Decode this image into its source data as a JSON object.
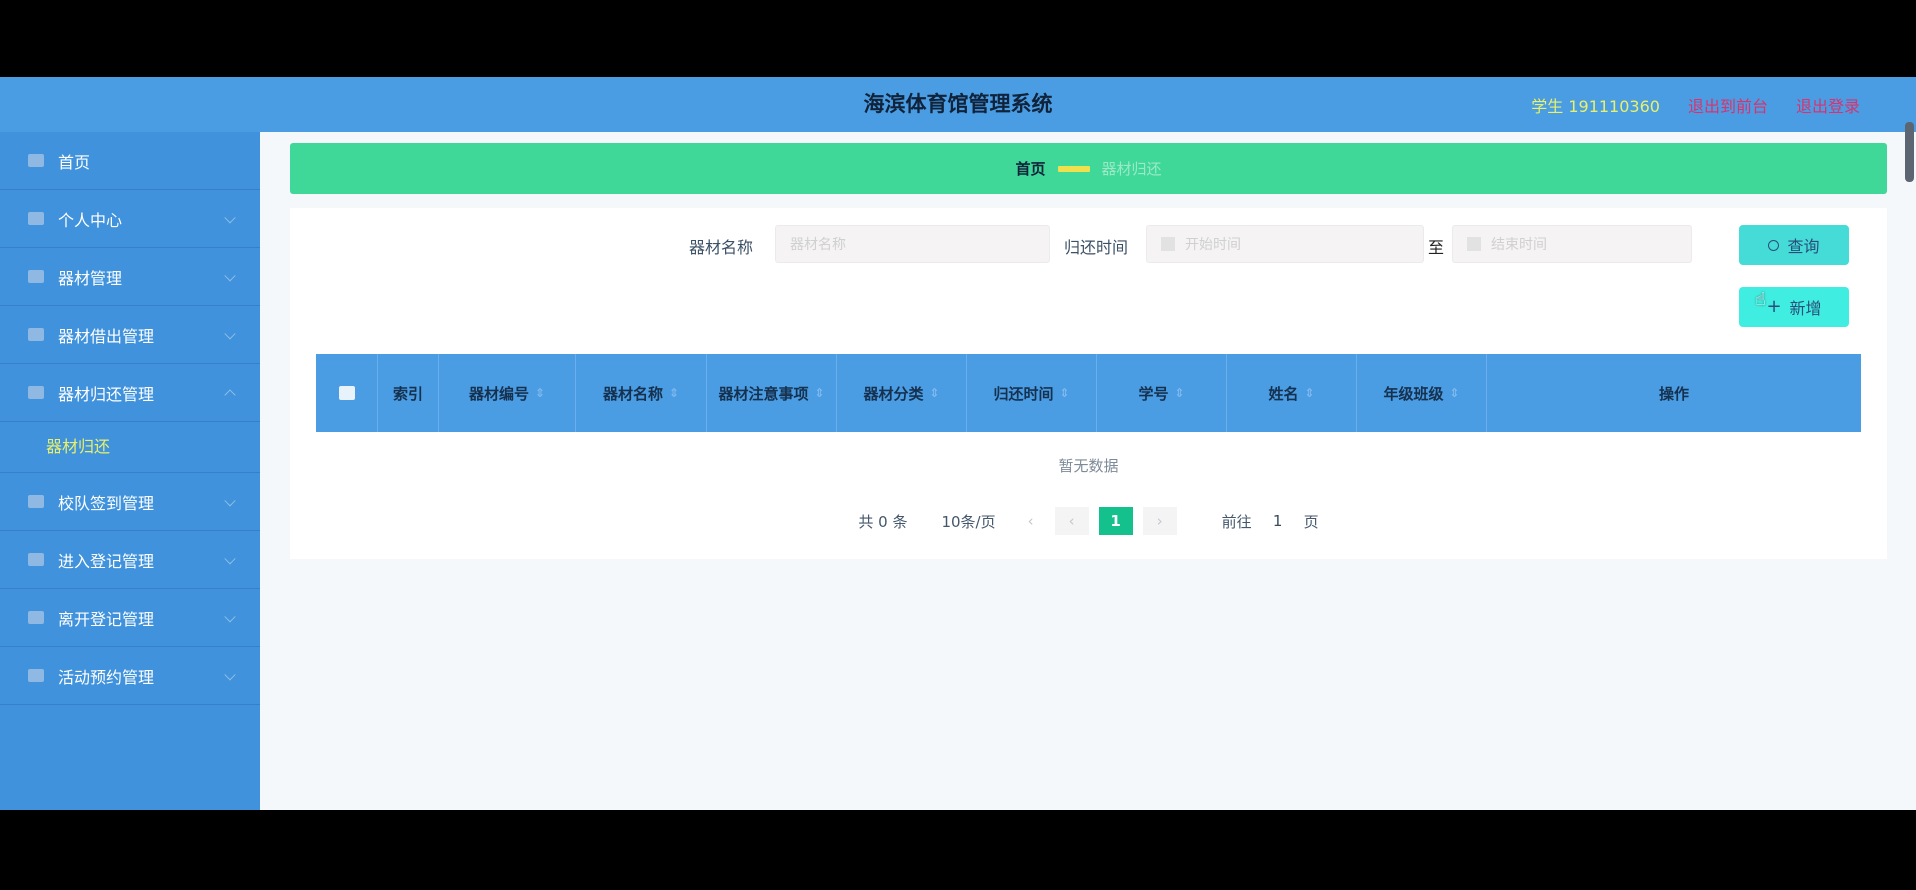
{
  "header": {
    "title": "海滨体育馆管理系统",
    "user": "学生 191110360",
    "link1": "退出到前台",
    "link2": "退出登录"
  },
  "sidebar": {
    "items": [
      {
        "label": "首页",
        "icon": "home-icon"
      },
      {
        "label": "个人中心",
        "icon": "user-icon"
      },
      {
        "label": "器材管理",
        "icon": "equipment-icon"
      },
      {
        "label": "器材借出管理",
        "icon": "lend-icon"
      },
      {
        "label": "器材归还管理",
        "icon": "return-icon"
      },
      {
        "label": "器材归还",
        "sub": true
      },
      {
        "label": "校队签到管理",
        "icon": "folder-icon"
      },
      {
        "label": "进入登记管理",
        "icon": "enter-icon"
      },
      {
        "label": "离开登记管理",
        "icon": "leave-icon"
      },
      {
        "label": "活动预约管理",
        "icon": "calendar-icon"
      }
    ]
  },
  "breadcrumb": {
    "home": "首页",
    "current": "器材归还"
  },
  "search": {
    "name_label": "器材名称",
    "name_placeholder": "器材名称",
    "time_label": "归还时间",
    "start_placeholder": "开始时间",
    "to_label": "至",
    "end_placeholder": "结束时间",
    "search_button": "查询",
    "add_button": "新增"
  },
  "table": {
    "columns": [
      "",
      "索引",
      "器材编号",
      "器材名称",
      "器材注意事项",
      "器材分类",
      "归还时间",
      "学号",
      "姓名",
      "年级班级",
      "操作"
    ],
    "empty_text": "暂无数据"
  },
  "pagination": {
    "total": "共 0 条",
    "page_size": "10条/页",
    "current_page": "1",
    "goto_label": "前往",
    "goto_value": "1",
    "page_unit": "页"
  },
  "colors": {
    "header": "#4a9de3",
    "sidebar": "#3f92db",
    "breadcrumb": "#3fd898",
    "accent_text": "#e9f06a",
    "active_page": "#14c08b"
  }
}
